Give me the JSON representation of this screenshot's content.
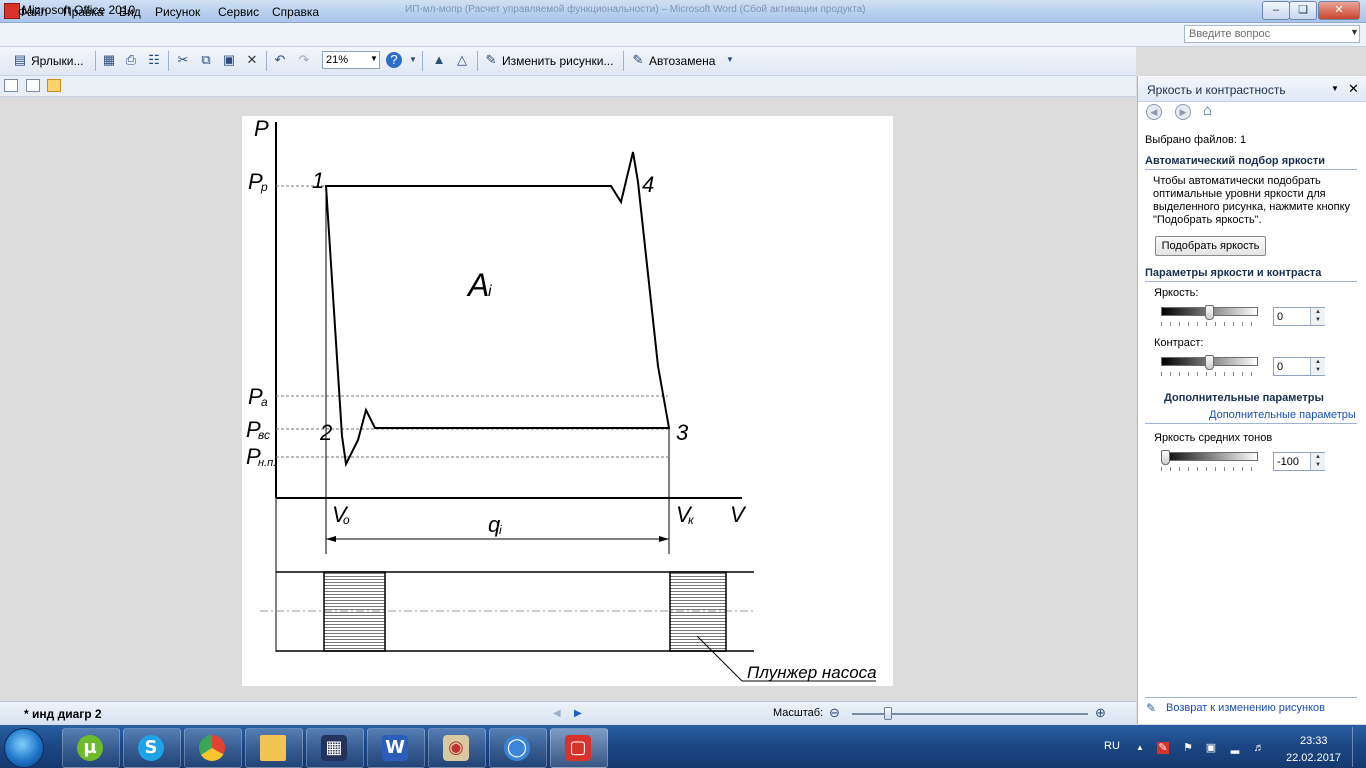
{
  "window": {
    "title": "Microsoft Office 2010",
    "title_faded": "ИП-мл-мопр (Расчет управляемой функциональности) – Microsoft Word (Сбой активации продукта)"
  },
  "menu": {
    "items": [
      "Файл",
      "Правка",
      "Вид",
      "Рисунок",
      "Сервис",
      "Справка"
    ],
    "help_placeholder": "Введите вопрос"
  },
  "toolbar": {
    "shortcuts_label": "Ярлыки...",
    "zoom_value": "21%",
    "edit_pictures_label": "Изменить рисунки...",
    "autocorrect_label": "Автозамена"
  },
  "diagram": {
    "axis_p": "P",
    "axis_v": "V",
    "label_pp": "P",
    "label_pp_sub": "р",
    "label_pa": "P",
    "label_pa_sub": "а",
    "label_pvs": "P",
    "label_pvs_sub": "вс",
    "label_pnp": "P",
    "label_pnp_sub": "н.п.",
    "point_1": "1",
    "point_2": "2",
    "point_3": "3",
    "point_4": "4",
    "work_label": "A",
    "work_sub": "i",
    "v0": "V",
    "v0_sub": "o",
    "vk": "V",
    "vk_sub": "к",
    "q": "q",
    "q_sub": "i",
    "plunger_caption": "Плунжер насоса"
  },
  "taskpane": {
    "title": "Яркость и контрастность",
    "selected_files": "Выбрано файлов: 1",
    "auto_heading": "Автоматический подбор яркости",
    "auto_line1": "Чтобы автоматически подобрать",
    "auto_line2": "оптимальные уровни яркости для",
    "auto_line3": "выделенного рисунка, нажмите кнопку",
    "auto_line4": "\"Подобрать яркость\".",
    "auto_button": "Подобрать яркость",
    "params_heading": "Параметры яркости и контраста",
    "brightness_label": "Яркость:",
    "brightness_value": "0",
    "contrast_label": "Контраст:",
    "contrast_value": "0",
    "extra_heading": "Дополнительные параметры",
    "extra_link": "Дополнительные параметры",
    "midtone_label": "Яркость средних тонов",
    "midtone_value": "-100",
    "back_link": "Возврат к изменению рисунков"
  },
  "controls": {
    "brightness_level": 0.5,
    "contrast_level": 0.5,
    "midtone_level": 0.0,
    "zoom_slider_level": 0.14
  },
  "statusbar": {
    "doc_name": "* инд диагр 2",
    "zoom_label": "Масштаб:"
  },
  "taskbar": {
    "apps": [
      "utorrent-icon",
      "skype-icon",
      "chrome-icon",
      "explorer-icon",
      "save-disk-icon",
      "word-icon",
      "paint-icon",
      "opera-icon",
      "office-picture-icon"
    ],
    "lang": "RU",
    "time": "23:33",
    "date": "22.02.2017"
  }
}
